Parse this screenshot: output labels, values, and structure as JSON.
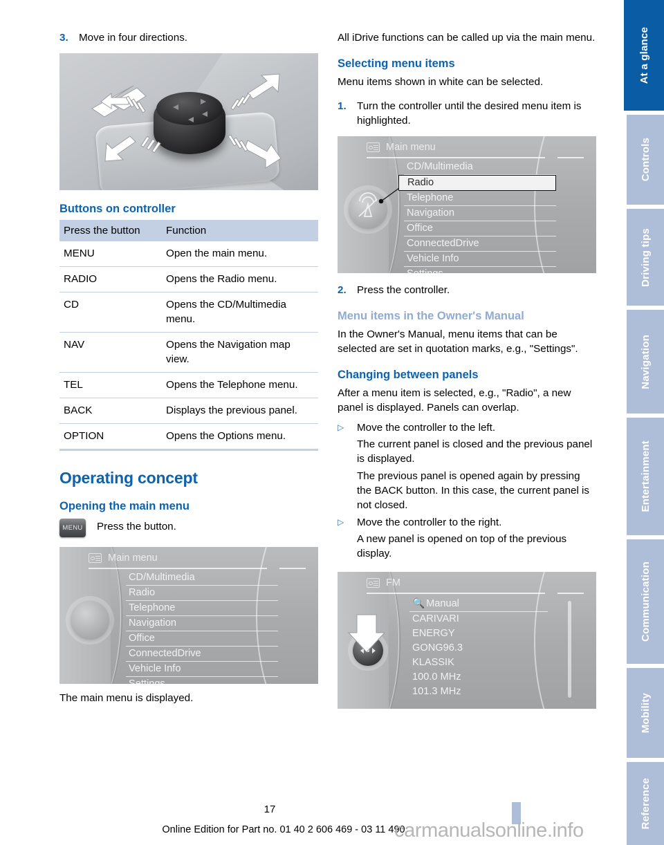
{
  "page": {
    "number": "17",
    "footer_note": "Online Edition for Part no. 01 40 2 606 469 - 03 11 490",
    "watermark": "carmanualsonline.info"
  },
  "left_column": {
    "step3": {
      "num": "3.",
      "text": "Move in four directions."
    },
    "photo_alt": "iDrive controller with four direction arrows",
    "heading_buttons": "Buttons on controller",
    "table": {
      "headers": [
        "Press the button",
        "Function"
      ],
      "rows": [
        {
          "button": "MENU",
          "function": "Open the main menu."
        },
        {
          "button": "RADIO",
          "function": "Opens the Radio menu."
        },
        {
          "button": "CD",
          "function": "Opens the CD/Multimedia menu."
        },
        {
          "button": "NAV",
          "function": "Opens the Navigation map view."
        },
        {
          "button": "TEL",
          "function": "Opens the Telephone menu."
        },
        {
          "button": "BACK",
          "function": "Displays the previous panel."
        },
        {
          "button": "OPTION",
          "function": "Opens the Options menu."
        }
      ]
    },
    "heading_operating": "Operating concept",
    "heading_opening": "Opening the main menu",
    "menu_button_label": "MENU",
    "press_button_text": "Press the button.",
    "display_main_menu": {
      "title": "Main menu",
      "items": [
        "CD/Multimedia",
        "Radio",
        "Telephone",
        "Navigation",
        "Office",
        "ConnectedDrive",
        "Vehicle Info",
        "Settings"
      ],
      "selected": null
    },
    "caption_main_menu": "The main menu is displayed."
  },
  "right_column": {
    "intro": "All iDrive functions can be called up via the main menu.",
    "heading_selecting": "Selecting menu items",
    "selecting_text": "Menu items shown in white can be selected.",
    "step1": {
      "num": "1.",
      "text": "Turn the controller until the desired menu item is highlighted."
    },
    "display_main_menu": {
      "title": "Main menu",
      "items": [
        "CD/Multimedia",
        "Radio",
        "Telephone",
        "Navigation",
        "Office",
        "ConnectedDrive",
        "Vehicle Info",
        "Settings"
      ],
      "selected": "Radio"
    },
    "step2": {
      "num": "2.",
      "text": "Press the controller."
    },
    "heading_menu_items_om": "Menu items in the Owner's Manual",
    "menu_items_om_text": "In the Owner's Manual, menu items that can be selected are set in quotation marks, e.g., \"Settings\".",
    "heading_changing": "Changing between panels",
    "changing_text": "After a menu item is selected, e.g., \"Radio\", a new panel is displayed. Panels can overlap.",
    "bullets": [
      {
        "marker": "▷",
        "text": "Move the controller to the left.",
        "paragraphs": [
          "The current panel is closed and the previous panel is displayed.",
          "The previous panel is opened again by pressing the BACK button. In this case, the current panel is not closed."
        ]
      },
      {
        "marker": "▷",
        "text": "Move the controller to the right.",
        "paragraphs": [
          "A new panel is opened on top of the previous display."
        ]
      }
    ],
    "display_fm": {
      "title": "FM",
      "search_label": "Manual",
      "items": [
        "CARIVARI",
        "ENERGY",
        "GONG96.3",
        "KLASSIK",
        "100.0  MHz",
        "101.3  MHz"
      ]
    }
  },
  "sidebar": {
    "tabs": [
      {
        "label": "At a glance",
        "active": true
      },
      {
        "label": "Controls",
        "active": false
      },
      {
        "label": "Driving tips",
        "active": false
      },
      {
        "label": "Navigation",
        "active": false
      },
      {
        "label": "Entertainment",
        "active": false
      },
      {
        "label": "Communication",
        "active": false
      },
      {
        "label": "Mobility",
        "active": false
      },
      {
        "label": "Reference",
        "active": false
      }
    ]
  },
  "colors": {
    "accent_blue": "#0d62ae",
    "tab_active": "#0a5ca4",
    "tab_inactive": "#aebdd8",
    "table_header": "#c3cfe2",
    "faded_heading": "#8fabd4"
  }
}
